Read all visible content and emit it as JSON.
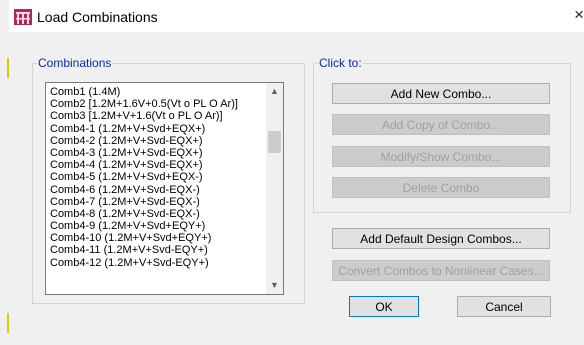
{
  "window": {
    "title": "Load Combinations",
    "close_glyph": "×",
    "app_icon": "etabs-app-icon"
  },
  "combinations": {
    "legend": "Combinations",
    "items": [
      "Comb1 (1.4M)",
      "Comb2 [1.2M+1.6V+0.5(Vt o PL O Ar)]",
      "Comb3 [1.2M+V+1.6(Vt o PL O Ar)]",
      "Comb4-1 (1.2M+V+Svd+EQX+)",
      "Comb4-2 (1.2M+V+Svd-EQX+)",
      "Comb4-3 (1.2M+V+Svd-EQX+)",
      "Comb4-4 (1.2M+V+Svd-EQX+)",
      "Comb4-5 (1.2M+V+Svd+EQX-)",
      "Comb4-6 (1.2M+V+Svd-EQX-)",
      "Comb4-7 (1.2M+V+Svd-EQX-)",
      "Comb4-8 (1.2M+V+Svd-EQX-)",
      "Comb4-9 (1.2M+V+Svd+EQY+)",
      "Comb4-10  (1.2M+V+Svd+EQY+)",
      "Comb4-11  (1.2M+V+Svd-EQY+)",
      "Comb4-12  (1.2M+V+Svd-EQY+)"
    ]
  },
  "click_to": {
    "legend": "Click to:",
    "add_new": "Add New Combo...",
    "add_copy": "Add Copy of Combo...",
    "modify_show": "Modify/Show Combo...",
    "delete": "Delete Combo"
  },
  "default_design": "Add Default Design Combos...",
  "convert_nonlinear": "Convert Combos to Nonlinear Cases...",
  "ok": "OK",
  "cancel": "Cancel",
  "scroll": {
    "up_glyph": "▲",
    "down_glyph": "▼"
  }
}
